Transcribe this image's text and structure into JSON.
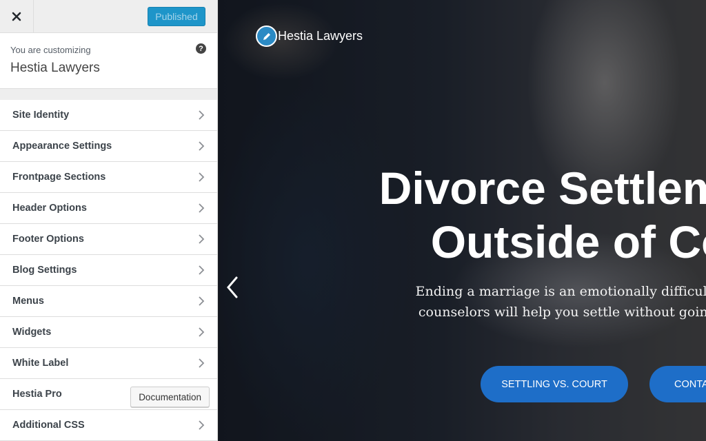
{
  "sidebar": {
    "close_icon": "close-icon",
    "publish_label": "Published",
    "customizing_label": "You are customizing",
    "site_title": "Hestia Lawyers",
    "help_glyph": "?",
    "items": [
      {
        "label": "Site Identity"
      },
      {
        "label": "Appearance Settings"
      },
      {
        "label": "Frontpage Sections"
      },
      {
        "label": "Header Options"
      },
      {
        "label": "Footer Options"
      },
      {
        "label": "Blog Settings"
      },
      {
        "label": "Menus"
      },
      {
        "label": "Widgets"
      },
      {
        "label": "White Label"
      },
      {
        "label": "Hestia Pro",
        "button": "Documentation"
      },
      {
        "label": "Additional CSS"
      }
    ]
  },
  "preview": {
    "brand_name": "Hestia Lawyers",
    "hero_title_line1": "Divorce Settlements",
    "hero_title_line2": "Outside of Court",
    "hero_sub_line1": "Ending a marriage is an emotionally difficult time. Our",
    "hero_sub_line2": "counselors will help you settle without going to court.",
    "cta_primary": "SETTLING VS. COURT",
    "cta_secondary": "CONTACT US",
    "accent_color": "#1e6ec8",
    "publish_color": "#1e95c9"
  }
}
